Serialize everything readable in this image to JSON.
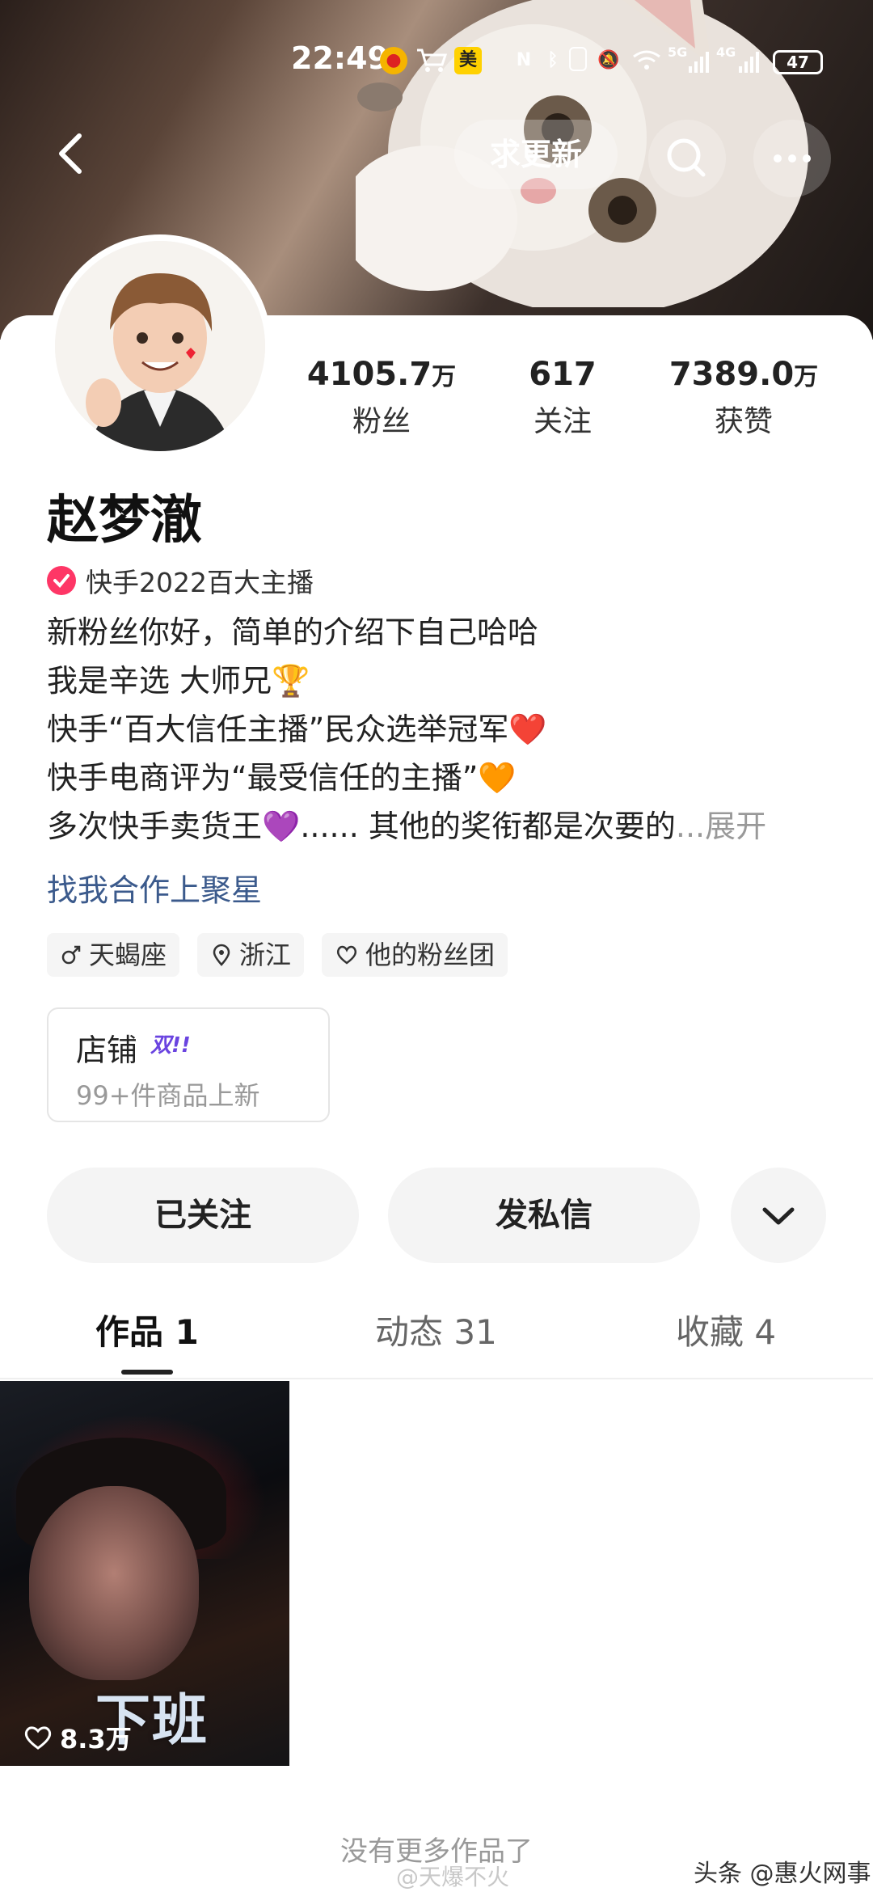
{
  "status_bar": {
    "time": "22:49",
    "meituan_label": "美",
    "battery": "47",
    "net1": "5G",
    "net2": "4G"
  },
  "header": {
    "request_update_label": "求更新"
  },
  "profile": {
    "name": "赵梦澈",
    "verification": "快手2022百大主播",
    "stats": [
      {
        "num": "4105.7",
        "unit": "万",
        "label": "粉丝"
      },
      {
        "num": "617",
        "unit": "",
        "label": "关注"
      },
      {
        "num": "7389.0",
        "unit": "万",
        "label": "获赞"
      }
    ],
    "bio": [
      "新粉丝你好，简单的介绍下自己哈哈",
      "我是辛选 大师兄🏆",
      "快手“百大信任主播”民众选举冠军❤️",
      "快手电商评为“最受信任的主播”🧡",
      "多次快手卖货王💜...... 其他的奖衔都是次要的"
    ],
    "bio_more": "...展开",
    "cooperation_link": "找我合作上聚星",
    "tags": [
      "天蝎座",
      "浙江",
      "他的粉丝团"
    ]
  },
  "shop": {
    "title": "店铺",
    "badge": "双!!",
    "subtitle": "99+件商品上新"
  },
  "actions": {
    "followed": "已关注",
    "message": "发私信"
  },
  "tabs": [
    {
      "label": "作品 1"
    },
    {
      "label": "动态 31"
    },
    {
      "label": "收藏 4"
    }
  ],
  "works": [
    {
      "caption": "下班",
      "likes": "8.3万"
    }
  ],
  "footer": {
    "no_more": "没有更多作品了",
    "watermark": "@天爆不火",
    "source": "头条 @惠火网事"
  },
  "colors": {
    "accent_link": "#3b5a8c",
    "verify_badge": "#fe3666",
    "shop_badge": "#6a44e0"
  },
  "icons": [
    "back-icon",
    "search-icon",
    "more-icon",
    "chevron-down-icon",
    "male-icon",
    "location-icon",
    "heart-icon"
  ]
}
